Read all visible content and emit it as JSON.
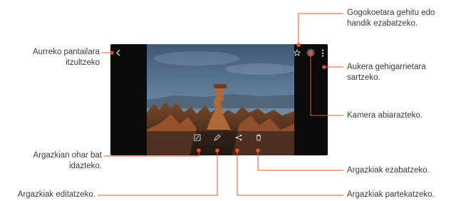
{
  "callouts": {
    "back": [
      "Aurreko pantailara",
      "itzultzeko"
    ],
    "favorite": [
      "Gogokoetara gehitu edo",
      "handik ezabatzeko."
    ],
    "more": [
      "Aukera gehigarrietara",
      "sartzeko."
    ],
    "camera": "Kamera abiarazteko.",
    "note": [
      "Argazkian ohar bat",
      "idazteko."
    ],
    "edit": "Argazkiak editatzeko.",
    "delete": "Argazkiak ezabatzeko.",
    "share": "Argazkiak partekatzeko."
  },
  "icons": {
    "back": "back-arrow-icon",
    "favorite": "star-icon",
    "camera": "camera-icon",
    "more": "more-options-icon",
    "note": "note-icon",
    "edit": "edit-icon",
    "share": "share-icon",
    "delete": "trash-icon"
  },
  "colors": {
    "callout_line": "#e8541e",
    "dot": "#e8541e",
    "device": "#0b0b0b"
  }
}
